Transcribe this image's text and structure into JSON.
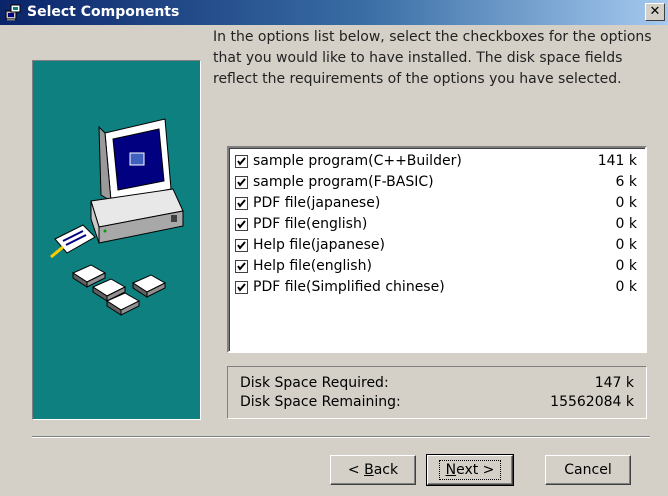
{
  "window": {
    "title": "Select Components",
    "close_label": "✕"
  },
  "description": "In the options list below, select the checkboxes for the options that you would like to have installed.  The disk space fields reflect the requirements of the options you have selected.",
  "options": [
    {
      "label": "sample program(C++Builder)",
      "size": "141 k",
      "checked": true
    },
    {
      "label": "sample program(F-BASIC)",
      "size": "6 k",
      "checked": true
    },
    {
      "label": "PDF file(japanese)",
      "size": "0 k",
      "checked": true
    },
    {
      "label": "PDF file(english)",
      "size": "0 k",
      "checked": true
    },
    {
      "label": "Help file(japanese)",
      "size": "0 k",
      "checked": true
    },
    {
      "label": "Help file(english)",
      "size": "0 k",
      "checked": true
    },
    {
      "label": "PDF file(Simplified chinese)",
      "size": "0 k",
      "checked": true
    }
  ],
  "disk": {
    "required_label": "Disk Space Required:",
    "required_value": "147 k",
    "remaining_label": "Disk Space Remaining:",
    "remaining_value": "15562084 k"
  },
  "buttons": {
    "back_prefix": "< ",
    "back_mnemonic": "B",
    "back_rest": "ack",
    "next_mnemonic": "N",
    "next_rest": "ext >",
    "cancel": "Cancel"
  },
  "colors": {
    "dialog_bg": "#d4d0c8",
    "art_panel_bg": "#0e8080",
    "title_bar_start": "#0a246a",
    "title_bar_end": "#a6caf0"
  },
  "icons": {
    "title": "setup-icon",
    "close": "close-icon",
    "checkbox": "check-icon",
    "illustration": "computer-with-disks-illustration"
  }
}
